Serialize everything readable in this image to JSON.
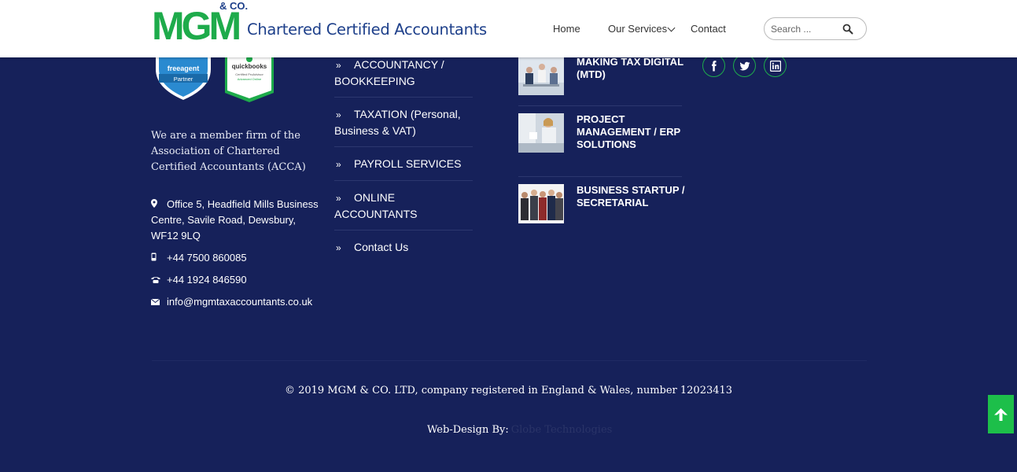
{
  "header": {
    "logo": {
      "mark": "MGM",
      "co": "& CO.",
      "tagline": "Chartered Certified Accountants"
    },
    "nav": {
      "home": "Home",
      "services": "Our Services",
      "contact": "Contact"
    },
    "search": {
      "placeholder": "Search ..."
    }
  },
  "badges": {
    "freeagent": {
      "brand": "freeagent",
      "label": "Partner"
    },
    "quickbooks": {
      "brand": "quickbooks",
      "line1": "Certified ProAdvisor",
      "line2": "Advanced Online"
    }
  },
  "about": "We are a member firm of the Association of Chartered Certified Accountants (ACCA)",
  "contact": {
    "address": "Office 5, Headfield Mills Business Centre, Savile Road, Dewsbury, WF12 9LQ",
    "mobile": "+44 7500 860085",
    "phone": "+44 1924 846590",
    "email": "info@mgmtaxaccountants.co.uk"
  },
  "services": {
    "items": [
      {
        "label": "ACCOUNTANCY / BOOKKEEPING"
      },
      {
        "label": "TAXATION (Personal, Business & VAT)"
      },
      {
        "label": "PAYROLL SERVICES"
      },
      {
        "label": "ONLINE ACCOUNTANTS"
      },
      {
        "label": "Contact Us"
      }
    ]
  },
  "posts": [
    {
      "title": "MAKING TAX DIGITAL (MTD)"
    },
    {
      "title": "PROJECT MANAGEMENT / ERP SOLUTIONS"
    },
    {
      "title": "BUSINESS STARTUP / SECRETARIAL"
    }
  ],
  "social": [
    "facebook-icon",
    "twitter-icon",
    "linkedin-icon"
  ],
  "footer": {
    "copyright": "© 2019 MGM & CO. LTD, company registered in England & Wales, number 12023413",
    "credit_label": "Web-Design By:",
    "credit_link": "Globe Technologies"
  },
  "colors": {
    "brand_green": "#1eab4b",
    "brand_blue": "#1d3f8a",
    "footer_bg": "#16215a",
    "back_to_top": "#1dbf4a"
  }
}
